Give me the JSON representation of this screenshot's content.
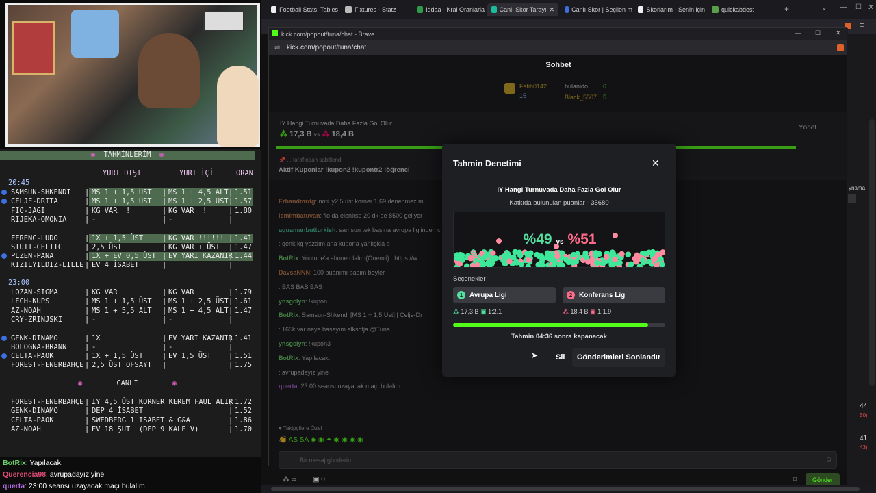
{
  "board": {
    "title": "TAHMİNLERİM",
    "col1": "YURT DIŞI",
    "col2": "YURT İÇİ",
    "col3": "ORAN",
    "time1": "20:45",
    "time2": "23:00",
    "section_live": "CANLI",
    "rows1": [
      {
        "m": "SAMSUN-SHKENDI",
        "a": "MS 1 + 1,5 ÜST",
        "b": "MS 1 + 4,5 ALT",
        "o": "1.51",
        "dot": true,
        "hl": true
      },
      {
        "m": "CELJE-DRITA",
        "a": "MS 1 + 1,5 ÜST",
        "b": "MS 1 + 2,5 ÜST",
        "o": "1.57",
        "dot": true,
        "hl": true
      },
      {
        "m": "FIO-JAGI",
        "a": "KG VAR  !",
        "b": "KG VAR  !",
        "o": "1.80",
        "dot": false,
        "hl": false
      },
      {
        "m": "RIJEKA-OMONIA",
        "a": "-",
        "b": "-",
        "o": "",
        "dot": false,
        "hl": false
      },
      {
        "m": "",
        "a": "",
        "b": "",
        "o": "",
        "dot": false,
        "hl": false
      },
      {
        "m": "FERENC-LUDO",
        "a": "1X + 1,5 ÜST",
        "b": "KG VAR !!!!!!",
        "o": "1.41",
        "dot": false,
        "hl": true
      },
      {
        "m": "STUTT-CELTIC",
        "a": "2,5 ÜST",
        "b": "KG VAR + ÜST",
        "o": "1.47",
        "dot": false,
        "hl": false
      },
      {
        "m": "PLZEN-PANA",
        "a": "1X + EV 0,5 ÜST",
        "b": "EV YARI KAZANIR",
        "o": "1.44",
        "dot": true,
        "hl": true
      },
      {
        "m": "KIZILYILDIZ-LILLE",
        "a": "EV 4 İSABET",
        "b": "",
        "o": "",
        "dot": false,
        "hl": false
      }
    ],
    "rows2": [
      {
        "m": "LOZAN-SIGMA",
        "a": "KG VAR",
        "b": "KG VAR",
        "o": "1.79",
        "dot": false
      },
      {
        "m": "LECH-KUPS",
        "a": "MS 1 + 1,5 ÜST",
        "b": "MS 1 + 2,5 ÜST",
        "o": "1.61",
        "dot": false
      },
      {
        "m": "AZ-NOAH",
        "a": "MS 1 + 5,5 ALT",
        "b": "MS 1 + 4,5 ALT",
        "o": "1.47",
        "dot": false
      },
      {
        "m": "CRY-ZRINJSKI",
        "a": "-",
        "b": "-",
        "o": "",
        "dot": false
      },
      {
        "m": "",
        "a": "",
        "b": "",
        "o": "",
        "dot": false
      },
      {
        "m": "GENK-DINAMO",
        "a": "1X",
        "b": "EV YARI KAZANIR",
        "o": "1.41",
        "dot": true
      },
      {
        "m": "BOLOGNA-BRANN",
        "a": "-",
        "b": "-",
        "o": "",
        "dot": false
      },
      {
        "m": "CELTA-PAOK",
        "a": "1X + 1,5 ÜST",
        "b": "EV 1,5 ÜST",
        "o": "1.51",
        "dot": true
      },
      {
        "m": "FOREST-FENERBAHÇE",
        "a": "2,5 ÜST OFSAYT",
        "b": "",
        "o": "1.75",
        "dot": false
      }
    ],
    "live": [
      {
        "m": "FOREST-FENERBAHÇE",
        "a": "IY 4,5 ÜST KORNER KEREM FAUL ALIR",
        "o": "1.72"
      },
      {
        "m": "GENK-DINAMO",
        "a": "DEP 4 İSABET",
        "o": "1.52"
      },
      {
        "m": "CELTA-PAOK",
        "a": "SWEDBERG 1 ISABET & G&A",
        "o": "1.86"
      },
      {
        "m": "AZ-NOAH",
        "a": "EV 18 ŞUT  (DEP 9 KALE V)",
        "o": "1.70"
      }
    ]
  },
  "overlay_chat": [
    {
      "user": "BotRix",
      "text": ": Yapılacak.",
      "color": "#6ad36a"
    },
    {
      "user": "Querencia98",
      "text": ": avrupadayız yine",
      "color": "#e04c74"
    },
    {
      "user": "querta",
      "text": ": 23:00 seansı uzayacak maçı bulalım",
      "color": "#b56ae0"
    }
  ],
  "browser": {
    "tabs": [
      {
        "label": "Football Stats, Tables",
        "color": "#eee",
        "active": false
      },
      {
        "label": "Fixtures - Statz",
        "color": "#bbb",
        "active": false
      },
      {
        "label": "iddaa - Kral Oranlarla",
        "color": "#2e9a4a",
        "active": false
      },
      {
        "label": "Canlı Skor Tarayı",
        "color": "#1abc9c",
        "active": true
      },
      {
        "label": "Canlı Skor | Seçilen m",
        "color": "#3d6fe0",
        "active": false
      },
      {
        "label": "Skorlarım - Senin için",
        "color": "#eee",
        "active": false
      },
      {
        "label": "quickabdest",
        "color": "#5aa04a",
        "active": false
      }
    ],
    "popup_title": "kick.com/popout/tuna/chat - Brave",
    "popup_url": "kick.com/popout/tuna/chat"
  },
  "chat": {
    "header": "Sohbet",
    "top1": {
      "name": "Fatih0142",
      "val": "15"
    },
    "top2": {
      "name": "bulanido",
      "val": "6"
    },
    "top3": {
      "name": "Black_5507",
      "val": "5"
    },
    "prediction_banner": "IY Hangi Turnuvada Daha Fazla Gol Olur",
    "banner_left": "17,3 B",
    "banner_vs": "vs",
    "banner_right": "18,4 B",
    "manage": "Yönet",
    "pinned_by": "tarafından sabitlendi",
    "pinned_text": "Aktif Kuponlar !kupon2 !kupontr2 !öğrenci",
    "messages": [
      {
        "user": "Erhandmrdg",
        "text": ": noti iy2,5 üst korner 1,69 denenmez mi",
        "color": "#c77d4a"
      },
      {
        "user": "icmimbatuvan",
        "text": ": fio da elenirse 20 dk de 8500 geliyor",
        "color": "#c77d4a"
      },
      {
        "user": "aquamanbutturkish",
        "text": ": samsun tek başına avrupa ligiinden ç",
        "color": "#4ac7a0"
      },
      {
        "user": "",
        "text": ": genk kg yazdım ana kupona yanlışkla b",
        "color": "#e04c74"
      },
      {
        "user": "BotRix",
        "text": ": Youtube'a abone olalım(Önemli) : https://w",
        "color": "#6ad36a"
      },
      {
        "user": "DavsaNNN",
        "text": ": 100 puanımı basım beyler",
        "color": "#c77d4a"
      },
      {
        "user": "",
        "text": ": BAS BAS BAS",
        "color": "#4a7fe0"
      },
      {
        "user": "ynsgclyn",
        "text": ": !kupon",
        "color": "#6ad36a"
      },
      {
        "user": "BotRix",
        "text": ": Samsun-Shkendi [MS 1 + 1,5 Üst] | Celje-Dr",
        "color": "#6ad36a"
      },
      {
        "user": "",
        "text": ": 165k var neye basayım alksdfja @Tuna",
        "color": "#4a7fe0"
      },
      {
        "user": "ynsgclyn",
        "text": ": !kupon3",
        "color": "#6ad36a"
      },
      {
        "user": "BotRix",
        "text": ": Yapılacak.",
        "color": "#6ad36a"
      },
      {
        "user": "",
        "text": ": avrupadayız yine",
        "color": "#e04c74"
      },
      {
        "user": "querta",
        "text": ": 23:00 seansı uzayacak maçı bulalım",
        "color": "#b56ae0"
      }
    ],
    "followers_only": "Takipçilere Özel",
    "input_placeholder": "Bir mesaj gönderin",
    "count": "0",
    "send": "Gönder",
    "side_text": "ynama",
    "side_num1": "44",
    "side_num1b": "50)",
    "side_num2": "41",
    "side_num2b": "43)"
  },
  "modal": {
    "title": "Tahmin Denetimi",
    "question": "IY Hangi Turnuvada Daha Fazla Gol Olur",
    "points": "Katkıda bulunulan puanlar - 35680",
    "pct_left": "%49",
    "vs": "vs",
    "pct_right": "%51",
    "share_left": 0.49,
    "options_label": "Seçenekler",
    "opt1": {
      "num": "1",
      "label": "Avrupa Ligi",
      "amount": "17,3 B",
      "ratio": "1:2.1"
    },
    "opt2": {
      "num": "2",
      "label": "Konferans Lig",
      "amount": "18,4 B",
      "ratio": "1:1.9"
    },
    "progress": 0.92,
    "timer": "Tahmin 04:36 sonra kapanacak",
    "delete": "Sil",
    "end": "Gönderimleri Sonlandır"
  }
}
